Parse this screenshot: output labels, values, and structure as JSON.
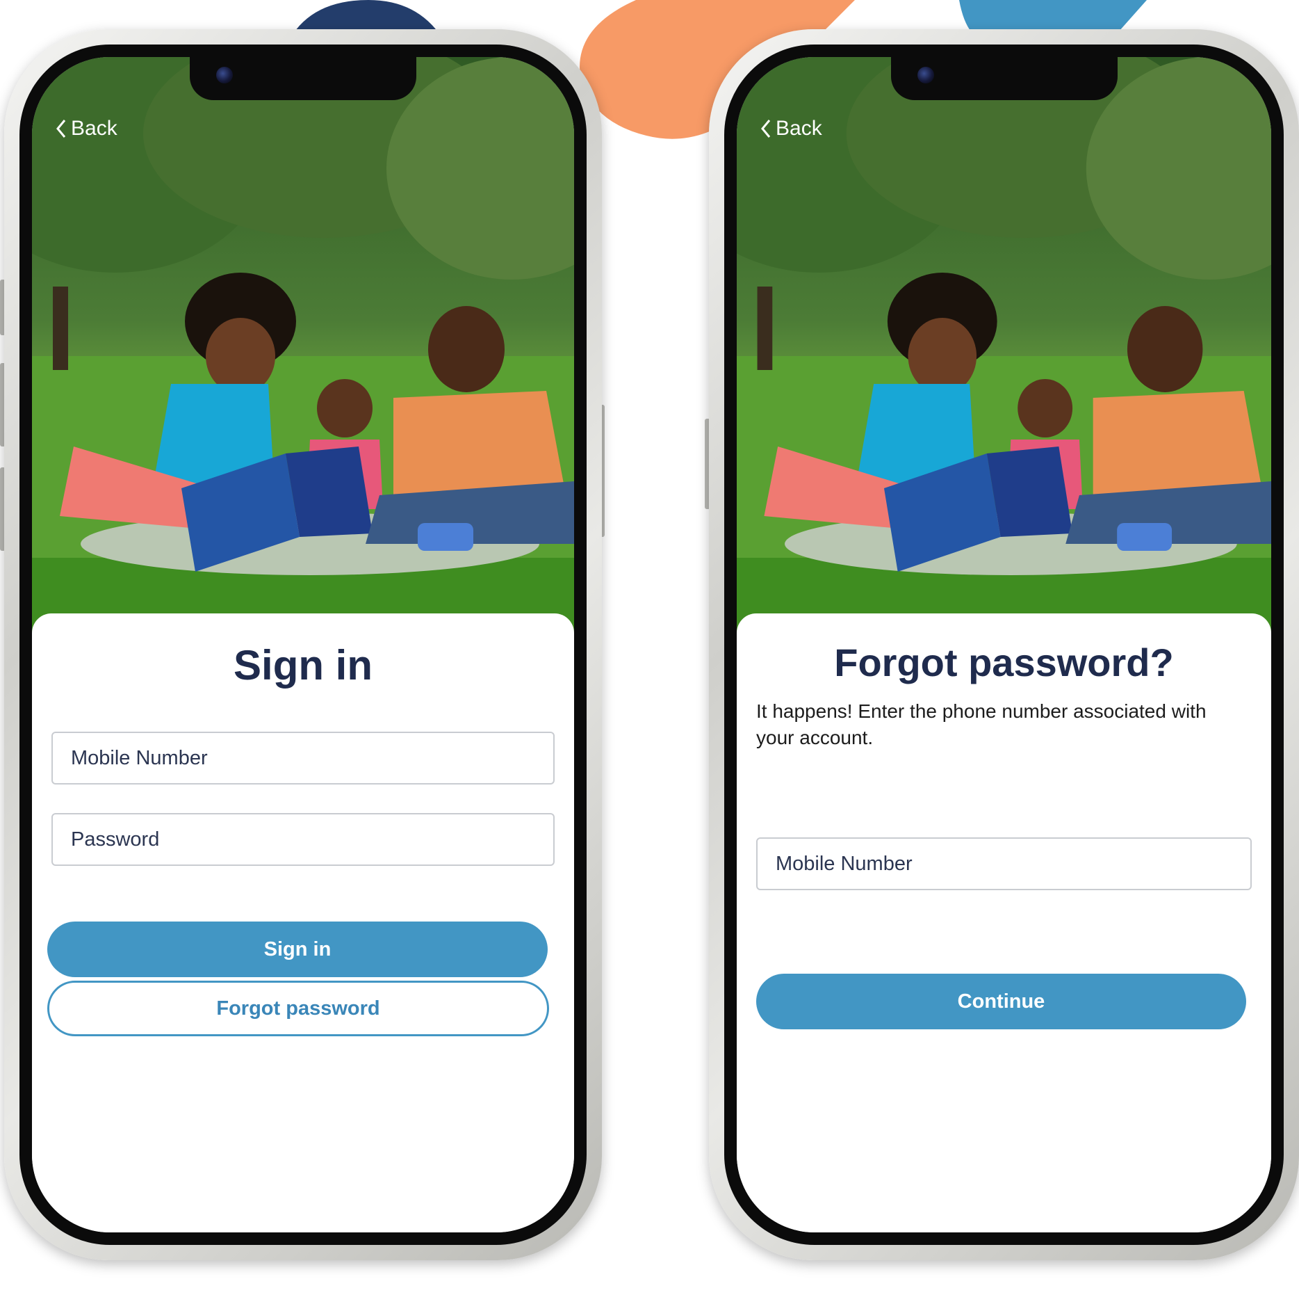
{
  "colors": {
    "navy": "#233d6b",
    "orange": "#f79a66",
    "blue": "#4296c4",
    "title": "#1f2b4d"
  },
  "signin_screen": {
    "back_label": "Back",
    "title": "Sign in",
    "mobile_placeholder": "Mobile Number",
    "password_placeholder": "Password",
    "signin_button": "Sign in",
    "forgot_button": "Forgot password"
  },
  "forgot_screen": {
    "back_label": "Back",
    "title": "Forgot password?",
    "description": "It happens! Enter the phone number associated with your account.",
    "mobile_placeholder": "Mobile Number",
    "continue_button": "Continue"
  }
}
